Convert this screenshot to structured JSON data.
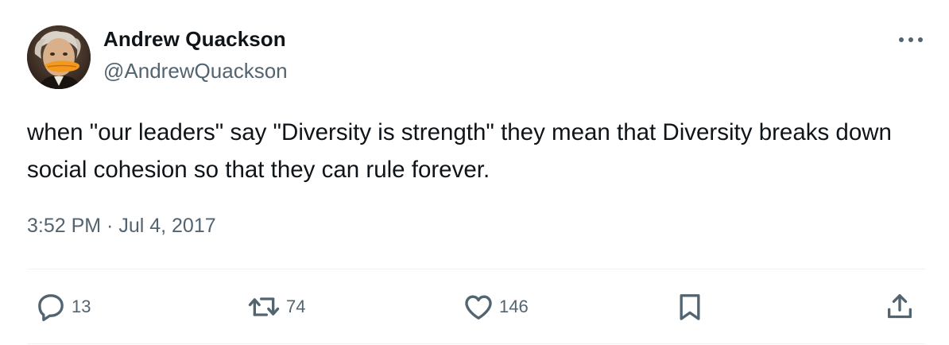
{
  "author": {
    "display_name": "Andrew Quackson",
    "handle": "@AndrewQuackson",
    "avatar_icon": "duck-bill-portrait-avatar"
  },
  "tweet": {
    "text": "when \"our leaders\" say \"Diversity is strength\" they mean that Diversity breaks down social cohesion so that they can rule forever.",
    "timestamp": "3:52 PM · Jul 4, 2017"
  },
  "actions": {
    "reply": {
      "icon": "reply-icon",
      "count": "13"
    },
    "repost": {
      "icon": "repost-icon",
      "count": "74"
    },
    "like": {
      "icon": "heart-icon",
      "count": "146"
    },
    "bookmark": {
      "icon": "bookmark-icon"
    },
    "share": {
      "icon": "share-icon"
    }
  },
  "colors": {
    "primary_text": "#0f1419",
    "secondary_text": "#536471",
    "divider": "#eff3f4"
  }
}
